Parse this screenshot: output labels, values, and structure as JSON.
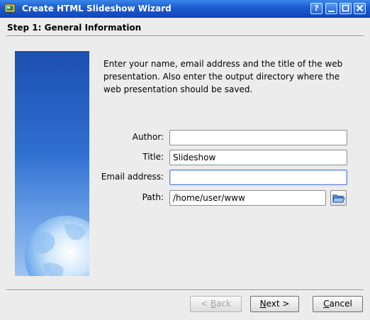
{
  "window": {
    "title": "Create HTML Slideshow Wizard",
    "controls": [
      "?",
      "_",
      "□",
      "✕"
    ]
  },
  "step": {
    "title": "Step 1: General Information"
  },
  "intro": "Enter your name, email address and the title of the web presentation. Also enter the output directory where the web presentation should be saved.",
  "form": {
    "author": {
      "label": "Author:",
      "value": ""
    },
    "title": {
      "label": "Title:",
      "value": "Slideshow"
    },
    "email": {
      "label": "Email address:",
      "value": ""
    },
    "path": {
      "label": "Path:",
      "value": "/home/user/www"
    }
  },
  "buttons": {
    "back": {
      "prefix": "< ",
      "mnemonic": "B",
      "rest": "ack"
    },
    "next": {
      "mnemonic": "N",
      "rest": "ext >"
    },
    "cancel": {
      "mnemonic": "C",
      "rest": "ancel"
    }
  },
  "colors": {
    "titlebar": "#1c5bd0",
    "panel_top": "#1c4fb0",
    "panel_bottom": "#9cc4f2"
  },
  "icons": {
    "app": "slideshow-icon",
    "folder": "folder-open-icon",
    "globe": "globe-icon"
  }
}
